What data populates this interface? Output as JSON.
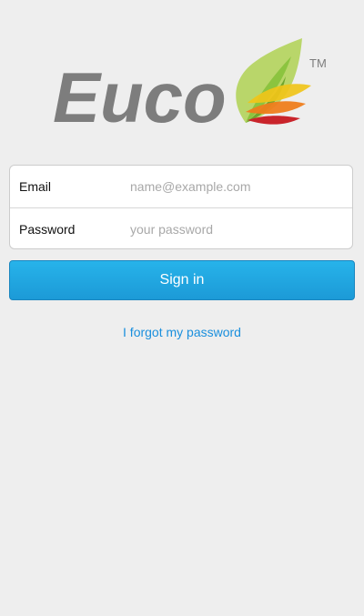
{
  "logo": {
    "wordmark": "Euco",
    "trademark": "TM",
    "colors": {
      "wordmark": "#7d7d7d",
      "leaf_light": "#b9d66a",
      "leaf_mid": "#8cc43f",
      "leaf_dark": "#6fa52e",
      "petal_yellow": "#f0c419",
      "petal_orange": "#ee7d1c",
      "petal_red": "#c9242b"
    }
  },
  "form": {
    "email": {
      "label": "Email",
      "placeholder": "name@example.com",
      "value": ""
    },
    "password": {
      "label": "Password",
      "placeholder": "your password",
      "value": ""
    }
  },
  "actions": {
    "signin_label": "Sign in",
    "forgot_label": "I forgot my password"
  },
  "colors": {
    "background": "#eeeeee",
    "primary_button": "#1c9ad7",
    "link": "#1a8fdd"
  }
}
